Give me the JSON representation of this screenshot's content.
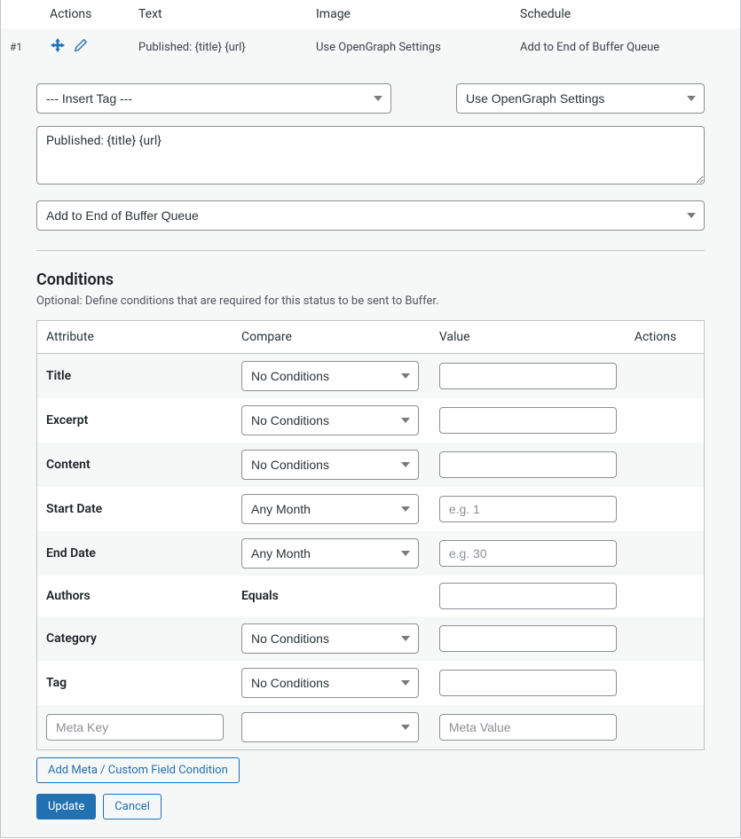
{
  "header": {
    "col_actions": "Actions",
    "col_text": "Text",
    "col_image": "Image",
    "col_schedule": "Schedule"
  },
  "row": {
    "id": "#1",
    "text": "Published: {title} {url}",
    "image": "Use OpenGraph Settings",
    "schedule": "Add to End of Buffer Queue"
  },
  "editor": {
    "insert_tag": "--- Insert Tag ---",
    "image_setting": "Use OpenGraph Settings",
    "message": "Published: {title} {url}",
    "schedule_setting": "Add to End of Buffer Queue"
  },
  "conditions": {
    "title": "Conditions",
    "desc": "Optional: Define conditions that are required for this status to be sent to Buffer.",
    "head_attribute": "Attribute",
    "head_compare": "Compare",
    "head_value": "Value",
    "head_actions": "Actions",
    "rows": {
      "title": {
        "label": "Title",
        "compare": "No Conditions"
      },
      "excerpt": {
        "label": "Excerpt",
        "compare": "No Conditions"
      },
      "content": {
        "label": "Content",
        "compare": "No Conditions"
      },
      "start_date": {
        "label": "Start Date",
        "compare": "Any Month",
        "placeholder": "e.g. 1"
      },
      "end_date": {
        "label": "End Date",
        "compare": "Any Month",
        "placeholder": "e.g. 30"
      },
      "authors": {
        "label": "Authors",
        "compare": "Equals"
      },
      "category": {
        "label": "Category",
        "compare": "No Conditions"
      },
      "tag": {
        "label": "Tag",
        "compare": "No Conditions"
      },
      "meta": {
        "key_placeholder": "Meta Key",
        "value_placeholder": "Meta Value"
      }
    },
    "add_meta_label": "Add Meta / Custom Field Condition"
  },
  "buttons": {
    "update": "Update",
    "cancel": "Cancel"
  }
}
